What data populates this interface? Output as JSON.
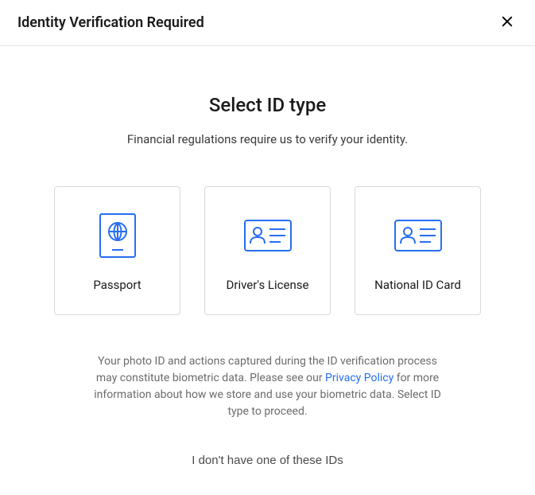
{
  "header": {
    "title": "Identity Verification Required"
  },
  "main": {
    "title": "Select ID type",
    "subtitle": "Financial regulations require us to verify your identity."
  },
  "options": [
    {
      "label": "Passport"
    },
    {
      "label": "Driver's License"
    },
    {
      "label": "National ID Card"
    }
  ],
  "biometric": {
    "part1": "Your photo ID and actions captured during the ID verification process may constitute biometric data. Please see our ",
    "link": "Privacy Policy",
    "part2": " for more information about how we store and use your biometric data. Select ID type to proceed."
  },
  "no_id_label": "I don't have one of these IDs"
}
